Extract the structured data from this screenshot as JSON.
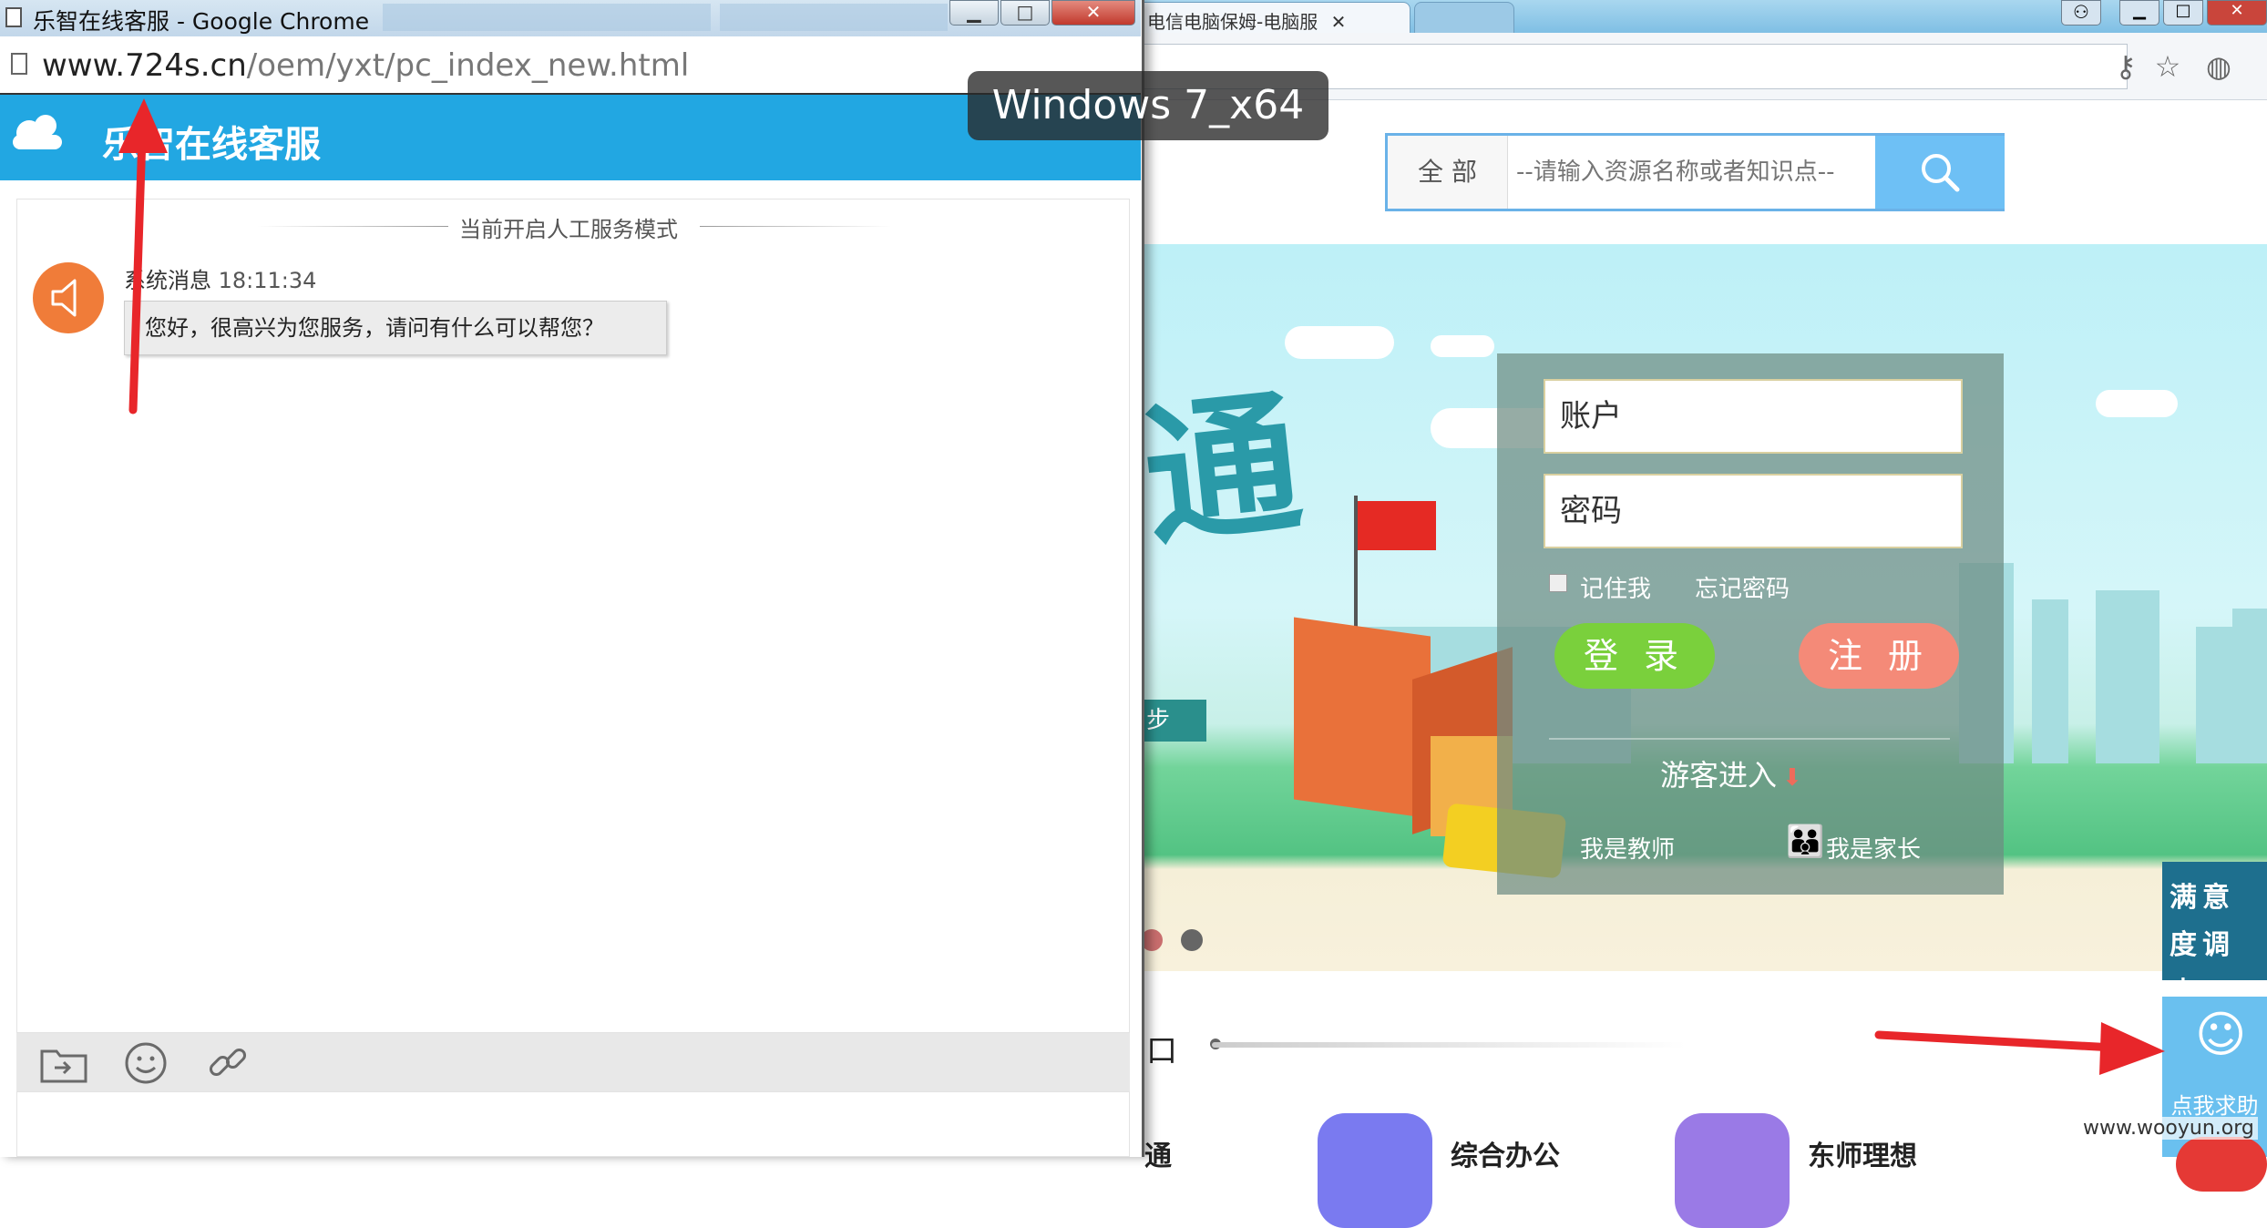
{
  "vm_label": "Windows 7_x64",
  "watermark": "www.wooyun.org",
  "colors": {
    "chat_header": "#22a7e2",
    "login_button": "#7ad03c",
    "register_button": "#f48a78",
    "annotation_arrow": "#e8262a",
    "survey_bg": "#1e6f8e",
    "helper_bg": "#6ac0ef"
  },
  "chat_window": {
    "title": "乐智在线客服 - Google Chrome",
    "url_host": "www.724s.cn",
    "url_path": "/oem/yxt/pc_index_new.html",
    "header_title": "乐智在线客服",
    "service_mode": "当前开启人工服务模式",
    "message": {
      "sender": "系统消息",
      "time": "18:11:34",
      "text": "您好，很高兴为您服务，请问有什么可以帮您？",
      "avatar_icon": "speaker-icon"
    },
    "toolbar_icons": [
      "send-file-icon",
      "emoji-icon",
      "link-icon"
    ]
  },
  "background_browser": {
    "tabs": [
      "电信电脑保姆-电脑服"
    ],
    "site": {
      "search": {
        "scope": "全 部",
        "placeholder": "--请输入资源名称或者知识点--"
      },
      "banner_char": "通",
      "banner_tag": "步",
      "login": {
        "account_placeholder": "账户",
        "password_placeholder": "密码",
        "remember": "记住我",
        "forgot": "忘记密码",
        "login_button": "登 录",
        "register_button": "注 册",
        "guest": "游客进入",
        "teacher": "我是教师",
        "parent": "我是家长"
      },
      "portal_label": "口",
      "portals": [
        {
          "label": "综合办公",
          "color": "#7a7af0"
        },
        {
          "label": "东师理想",
          "color": "#9a7ae6"
        }
      ],
      "portal_partial_left": "通",
      "survey_text": "满意度调 查",
      "helper_text": "点我求助"
    }
  }
}
